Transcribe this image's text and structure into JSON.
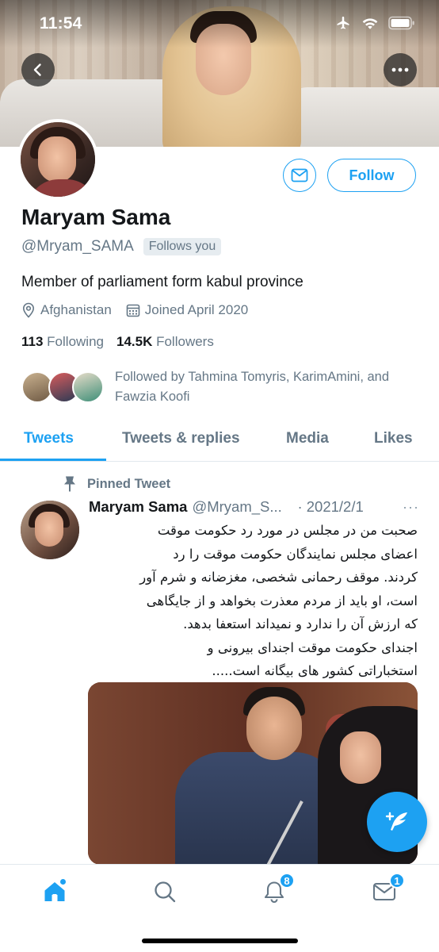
{
  "status_bar": {
    "time": "11:54"
  },
  "profile": {
    "display_name": "Maryam Sama",
    "handle": "@Mryam_SAMA",
    "follows_you": "Follows you",
    "bio": "Member of parliament form kabul province",
    "location": "Afghanistan",
    "joined": "Joined April 2020",
    "following_count": "113",
    "following_label": "Following",
    "followers_count": "14.5K",
    "followers_label": "Followers",
    "followed_by": "Followed by Tahmina Tomyris, KarimAmini, and Fawzia Koofi",
    "follow_button": "Follow"
  },
  "tabs": [
    {
      "label": "Tweets",
      "active": true
    },
    {
      "label": "Tweets & replies",
      "active": false
    },
    {
      "label": "Media",
      "active": false
    },
    {
      "label": "Likes",
      "active": false
    }
  ],
  "tweet": {
    "pinned_label": "Pinned Tweet",
    "author_name": "Maryam Sama",
    "author_handle": "@Mryam_S...",
    "date": "· 2021/2/1",
    "more": "···",
    "text_lines": [
      "صحبت من در مجلس در مورد رد حکومت موقت",
      "اعضای مجلس نمایندگان حکومت موقت را رد",
      "کردند. موقف رحمانی شخصی، مغزضانه و شرم آور",
      "است، او باید از مردم معذرت بخواهد و از جایگاهی",
      "که ارزش آن را ندارد و نمیداند استعفا بدهد.",
      "اجندای حکومت موقت اجندای بیرونی و",
      "استخباراتی کشور های بیگانه است....."
    ]
  },
  "bottom_nav": {
    "notifications_badge": "8",
    "messages_badge": "1"
  },
  "icons": {
    "back": "back-arrow-icon",
    "more": "more-dots-icon",
    "mail": "envelope-icon",
    "location": "location-pin-icon",
    "calendar": "calendar-icon",
    "pin": "pin-icon",
    "compose": "compose-tweet-icon",
    "home": "home-icon",
    "search": "search-icon",
    "notifications": "bell-icon",
    "messages": "envelope-icon"
  },
  "colors": {
    "accent": "#1da1f2",
    "secondary_text": "#657786",
    "primary_text": "#14171a"
  }
}
